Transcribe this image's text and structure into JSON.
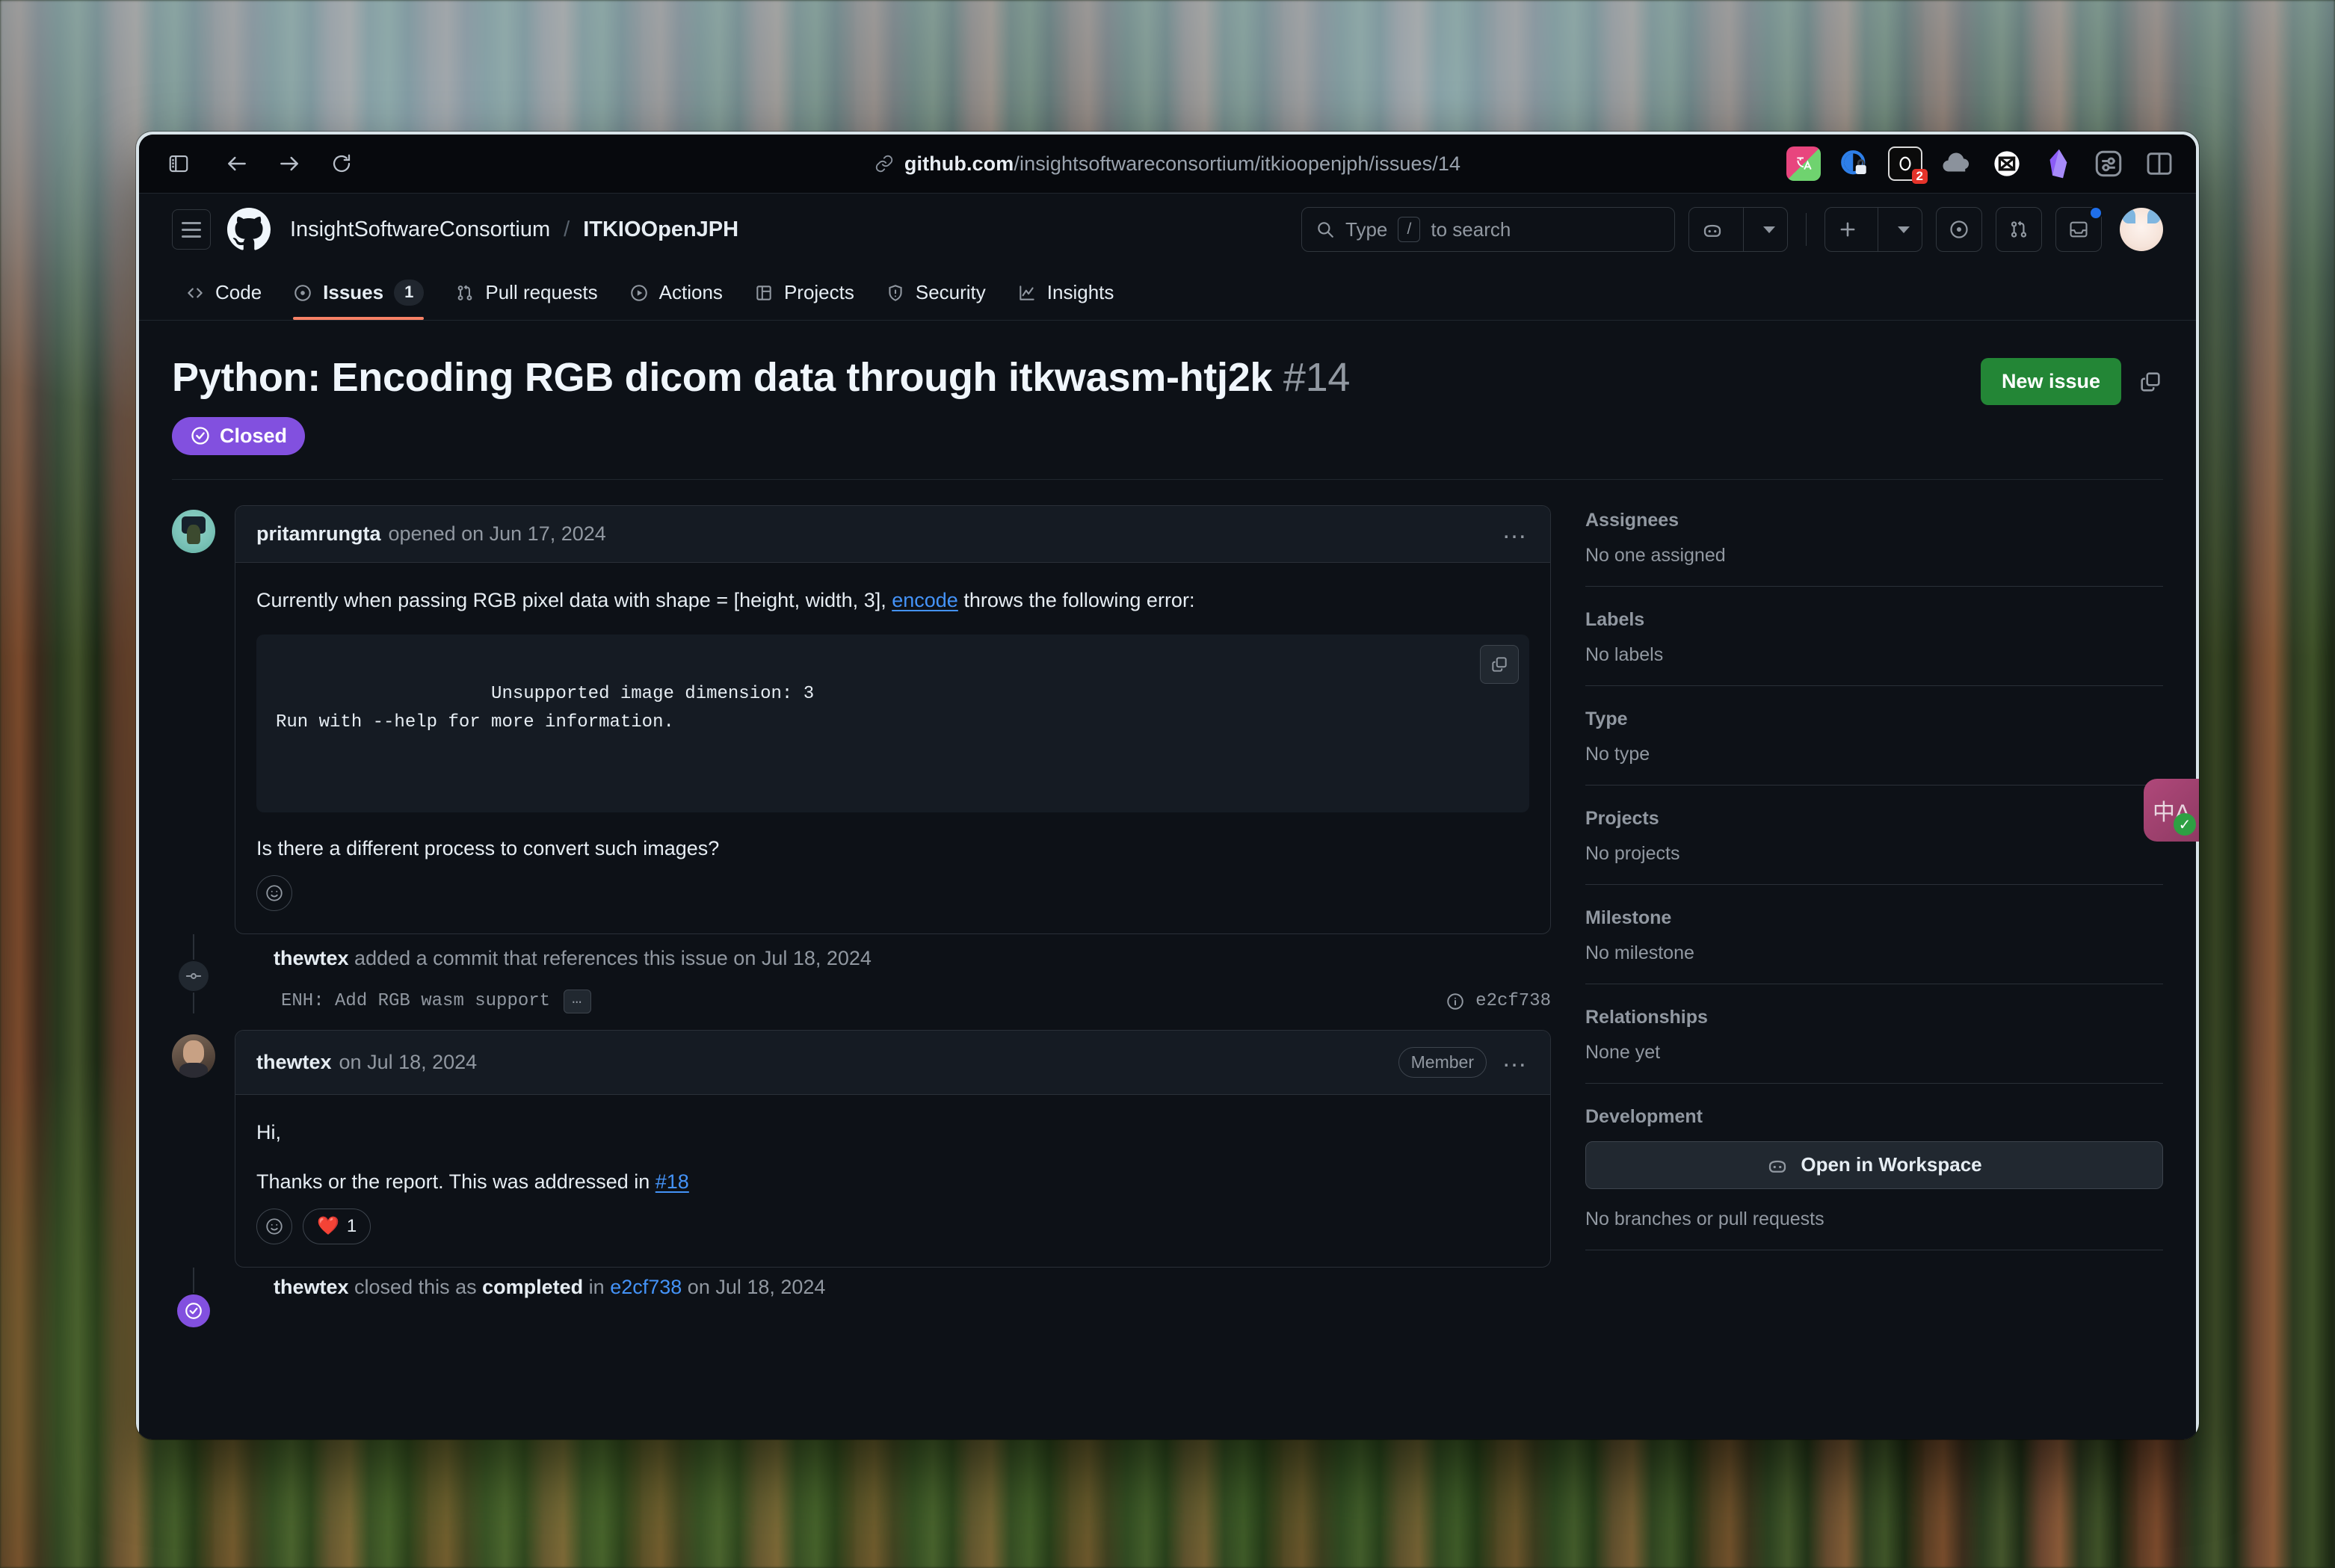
{
  "browser": {
    "url_domain": "github.com",
    "url_path": "/insightsoftwareconsortium/itkioopenjph/issues/14",
    "nav": {
      "sidebar_toggle": "sidebar-toggle",
      "back": "back",
      "forward": "forward",
      "reload": "reload"
    },
    "extensions": [
      {
        "name": "translate-extension-icon",
        "badge": ""
      },
      {
        "name": "privacy-lock-extension-icon",
        "badge": ""
      },
      {
        "name": "notion-extension-icon",
        "badge": "2"
      },
      {
        "name": "cloud-extension-icon",
        "badge": ""
      },
      {
        "name": "mailbox-extension-icon",
        "badge": ""
      },
      {
        "name": "obsidian-extension-icon",
        "badge": ""
      },
      {
        "name": "settings-extension-icon",
        "badge": ""
      },
      {
        "name": "split-view-icon",
        "badge": ""
      }
    ]
  },
  "github_header": {
    "owner": "InsightSoftwareConsortium",
    "separator": "/",
    "repo": "ITKIOOpenJPH",
    "search_placeholder": "Type",
    "search_key": "/",
    "search_suffix": "to search",
    "icons": {
      "copilot": "copilot-icon",
      "plus": "plus-icon",
      "issues": "issues-icon",
      "pull_requests": "pull-requests-icon",
      "inbox": "inbox-icon",
      "avatar": "user-avatar"
    }
  },
  "repo_nav": {
    "items": [
      {
        "label": "Code",
        "icon": "code-icon",
        "count": "",
        "active": false
      },
      {
        "label": "Issues",
        "icon": "issue-opened-icon",
        "count": "1",
        "active": true
      },
      {
        "label": "Pull requests",
        "icon": "git-pull-request-icon",
        "count": "",
        "active": false
      },
      {
        "label": "Actions",
        "icon": "play-icon",
        "count": "",
        "active": false
      },
      {
        "label": "Projects",
        "icon": "table-icon",
        "count": "",
        "active": false
      },
      {
        "label": "Security",
        "icon": "shield-icon",
        "count": "",
        "active": false
      },
      {
        "label": "Insights",
        "icon": "graph-icon",
        "count": "",
        "active": false
      }
    ]
  },
  "issue": {
    "title": "Python: Encoding RGB dicom data through itkwasm-htj2k",
    "number": "#14",
    "state": "Closed",
    "state_color": "#8250df",
    "new_issue_label": "New issue",
    "copy_icon": "copy-icon"
  },
  "timeline": {
    "first_comment": {
      "author": "pritamrungta",
      "meta": "opened on Jun 17, 2024",
      "avatar": "pritamrungta-avatar",
      "paragraph_1_before": "Currently when passing RGB pixel data with shape = [height, width, 3], ",
      "paragraph_1_link": "encode",
      "paragraph_1_after": " throws the following error:",
      "code": "Unsupported image dimension: 3\nRun with --help for more information.",
      "paragraph_2": "Is there a different process to convert such images?",
      "kebab": "…",
      "react_icon": "smiley-plus-icon"
    },
    "commit_event": {
      "avatar": "thewtex-avatar",
      "author": "thewtex",
      "text": "added a commit that references this issue on Jul 18, 2024",
      "commit_message": "ENH: Add RGB wasm support",
      "commit_ellipsis": "…",
      "commit_sha": "e2cf738",
      "info_icon": "info-icon",
      "badge_icon": "commit-dot-icon"
    },
    "second_comment": {
      "author": "thewtex",
      "meta": "on Jul 18, 2024",
      "avatar": "thewtex-avatar",
      "role_badge": "Member",
      "kebab": "…",
      "paragraph_1": "Hi,",
      "paragraph_2_before": "Thanks or the report. This was addressed in ",
      "paragraph_2_link": "#18",
      "react_icon": "smiley-plus-icon",
      "reaction_emoji": "❤️",
      "reaction_count": "1"
    },
    "closed_event": {
      "avatar": "thewtex-avatar",
      "author": "thewtex",
      "text_before": "closed this as ",
      "text_bold": "completed",
      "text_mid": " in ",
      "link": "e2cf738",
      "text_after": " on Jul 18, 2024",
      "badge_icon": "issue-closed-icon",
      "badge_color": "#8250df"
    }
  },
  "sidebar": {
    "sections": [
      {
        "title": "Assignees",
        "value": "No one assigned"
      },
      {
        "title": "Labels",
        "value": "No labels"
      },
      {
        "title": "Type",
        "value": "No type"
      },
      {
        "title": "Projects",
        "value": "No projects"
      },
      {
        "title": "Milestone",
        "value": "No milestone"
      },
      {
        "title": "Relationships",
        "value": "None yet"
      }
    ],
    "development": {
      "title": "Development",
      "button_label": "Open in Workspace",
      "button_icon": "copilot-icon",
      "empty_text": "No branches or pull requests"
    }
  },
  "floating_widget": {
    "name": "translate-widget",
    "glyph": "中A",
    "check": "✓"
  }
}
